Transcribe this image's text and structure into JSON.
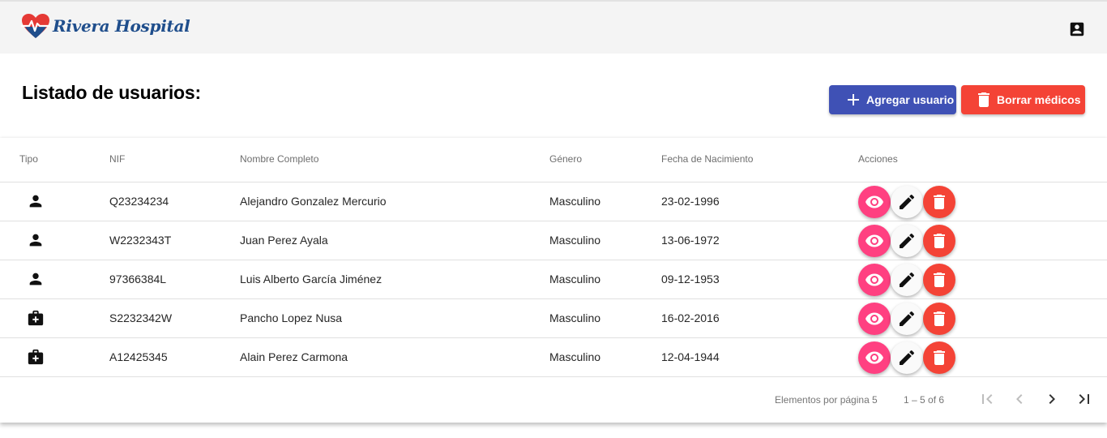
{
  "header": {
    "logo_text": "Rivera Hospital",
    "icons": {
      "logo": "heart-pulse-icon",
      "account": "account-box-icon"
    }
  },
  "page": {
    "title": "Listado de usuarios:",
    "add_button": "Agregar usuario",
    "delete_button": "Borrar médicos"
  },
  "table": {
    "columns": [
      "Tipo",
      "NIF",
      "Nombre Completo",
      "Género",
      "Fecha de Nacimiento",
      "Acciones"
    ],
    "rows": [
      {
        "tipo_icon": "person-icon",
        "nif": "Q23234234",
        "nombre": "Alejandro Gonzalez Mercurio",
        "genero": "Masculino",
        "fecha": "23-02-1996"
      },
      {
        "tipo_icon": "person-icon",
        "nif": "W2232343T",
        "nombre": "Juan Perez Ayala",
        "genero": "Masculino",
        "fecha": "13-06-1972"
      },
      {
        "tipo_icon": "person-icon",
        "nif": "97366384L",
        "nombre": "Luis Alberto García Jiménez",
        "genero": "Masculino",
        "fecha": "09-12-1953"
      },
      {
        "tipo_icon": "medical-bag-icon",
        "nif": "S2232342W",
        "nombre": "Pancho Lopez Nusa",
        "genero": "Masculino",
        "fecha": "16-02-2016"
      },
      {
        "tipo_icon": "medical-bag-icon",
        "nif": "A12425345",
        "nombre": "Alain Perez Carmona",
        "genero": "Masculino",
        "fecha": "12-04-1944"
      }
    ],
    "actions": [
      "eye-icon",
      "pencil-icon",
      "trash-icon"
    ]
  },
  "paginator": {
    "label": "Elementos por página",
    "page_size": "5",
    "range": "1 – 5 of 6"
  },
  "colors": {
    "primary": "#3f51b5",
    "accent": "#ff4081",
    "warn": "#f44336",
    "topbar": "#f4f4f4",
    "logo_text": "#1f4e8c"
  }
}
